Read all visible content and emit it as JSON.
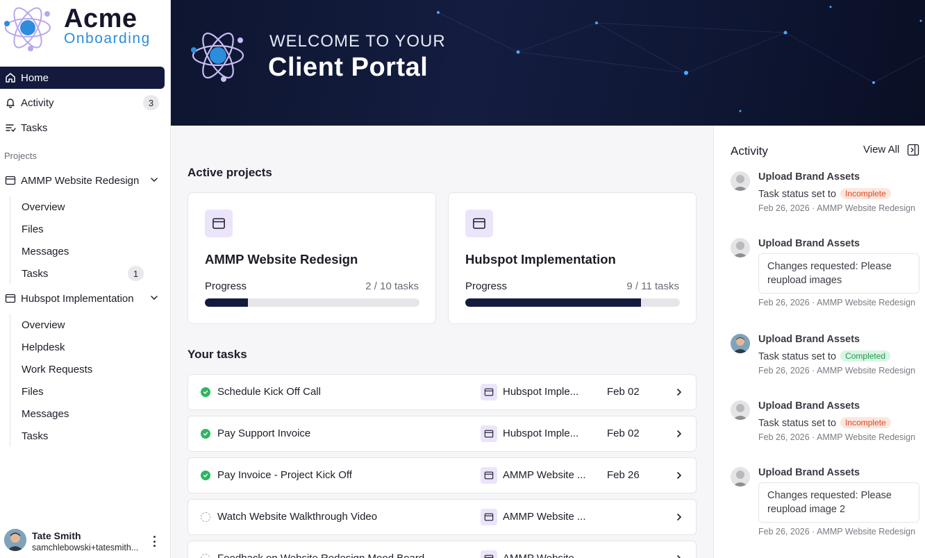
{
  "brand": {
    "title": "Acme",
    "subtitle": "Onboarding"
  },
  "nav": {
    "home": "Home",
    "activity": "Activity",
    "activity_count": "3",
    "tasks": "Tasks"
  },
  "projects_label": "Projects",
  "projects": [
    {
      "name": "AMMP Website Redesign",
      "items": [
        {
          "label": "Overview"
        },
        {
          "label": "Files"
        },
        {
          "label": "Messages"
        },
        {
          "label": "Tasks",
          "badge": "1"
        }
      ]
    },
    {
      "name": "Hubspot Implementation",
      "items": [
        {
          "label": "Overview"
        },
        {
          "label": "Helpdesk"
        },
        {
          "label": "Work Requests"
        },
        {
          "label": "Files"
        },
        {
          "label": "Messages"
        },
        {
          "label": "Tasks"
        }
      ]
    }
  ],
  "user": {
    "name": "Tate Smith",
    "email": "samchlebowski+tatesmith..."
  },
  "banner": {
    "eyebrow": "WELCOME TO YOUR",
    "title": "Client Portal"
  },
  "active_projects": {
    "heading": "Active projects",
    "cards": [
      {
        "title": "AMMP Website Redesign",
        "progress_label": "Progress",
        "count": "2 / 10 tasks",
        "progress": 0.2
      },
      {
        "title": "Hubspot Implementation",
        "progress_label": "Progress",
        "count": "9 / 11 tasks",
        "progress": 0.818
      }
    ]
  },
  "tasks": {
    "heading": "Your tasks",
    "rows": [
      {
        "name": "Schedule Kick Off Call",
        "project": "Hubspot Imple...",
        "date": "Feb 02",
        "status": "done"
      },
      {
        "name": "Pay Support Invoice",
        "project": "Hubspot Imple...",
        "date": "Feb 02",
        "status": "done"
      },
      {
        "name": "Pay Invoice - Project Kick Off",
        "project": "AMMP Website ...",
        "date": "Feb 26",
        "status": "done"
      },
      {
        "name": "Watch Website Walkthrough Video",
        "project": "AMMP Website ...",
        "date": "",
        "status": "todo"
      },
      {
        "name": "Feedback on Website Redesign Mood Board",
        "project": "AMMP Website ...",
        "date": "",
        "status": "todo"
      }
    ]
  },
  "activity": {
    "title": "Activity",
    "view_all": "View All",
    "items": [
      {
        "title": "Upload Brand Assets",
        "text": "Task status set to",
        "pill": "Incomplete",
        "meta": "Feb 26, 2026 · AMMP Website Redesign"
      },
      {
        "title": "Upload Brand Assets",
        "box": "Changes requested: Please reupload images",
        "meta": "Feb 26, 2026 · AMMP Website Redesign"
      },
      {
        "title": "Upload Brand Assets",
        "text": "Task status set to",
        "pill": "Completed",
        "meta": "Feb 26, 2026 · AMMP Website Redesign"
      },
      {
        "title": "Upload Brand Assets",
        "text": "Task status set to",
        "pill": "Incomplete",
        "meta": "Feb 26, 2026 · AMMP Website Redesign"
      },
      {
        "title": "Upload Brand Assets",
        "box": "Changes requested: Please reupload image 2",
        "meta": "Feb 26, 2026 · AMMP Website Redesign"
      }
    ]
  }
}
